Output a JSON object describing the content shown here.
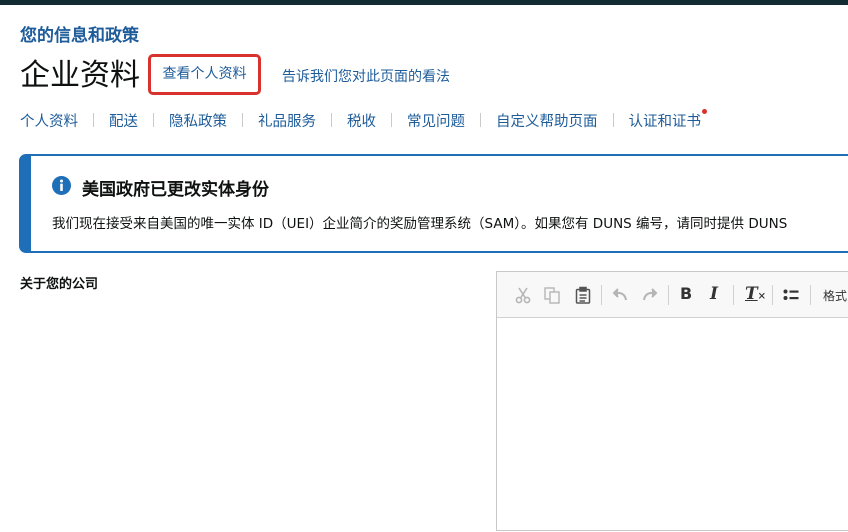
{
  "header": {
    "section_title": "您的信息和政策",
    "page_title": "企业资料",
    "view_profile_link": "查看个人资料",
    "feedback_link": "告诉我们您对此页面的看法"
  },
  "subnav": {
    "items": [
      {
        "label": "个人资料"
      },
      {
        "label": "配送"
      },
      {
        "label": "隐私政策"
      },
      {
        "label": "礼品服务"
      },
      {
        "label": "税收"
      },
      {
        "label": "常见问题"
      },
      {
        "label": "自定义帮助页面"
      },
      {
        "label": "认证和证书",
        "has_notification": true
      }
    ]
  },
  "alert": {
    "icon": "info-icon",
    "title": "美国政府已更改实体身份",
    "body": "我们现在接受来自美国的唯一实体 ID（UEI）企业简介的奖励管理系统（SAM）。如果您有 DUNS 编号，请同时提供 DUNS"
  },
  "company": {
    "label": "关于您的公司"
  },
  "editor": {
    "toolbar": {
      "buttons": [
        "cut-icon",
        "copy-icon",
        "paste-icon",
        "undo-icon",
        "redo-icon",
        "bold-icon",
        "italic-icon",
        "remove-format-icon",
        "bulleted-list-icon"
      ],
      "bold_glyph": "B",
      "italic_glyph": "I",
      "remove_format_glyph": "T",
      "format_label": "格式"
    },
    "content": ""
  },
  "colors": {
    "link": "#1e5c9a",
    "alert_border": "#1e6fb8",
    "highlight": "#d8322e",
    "topbar": "#132b33"
  }
}
